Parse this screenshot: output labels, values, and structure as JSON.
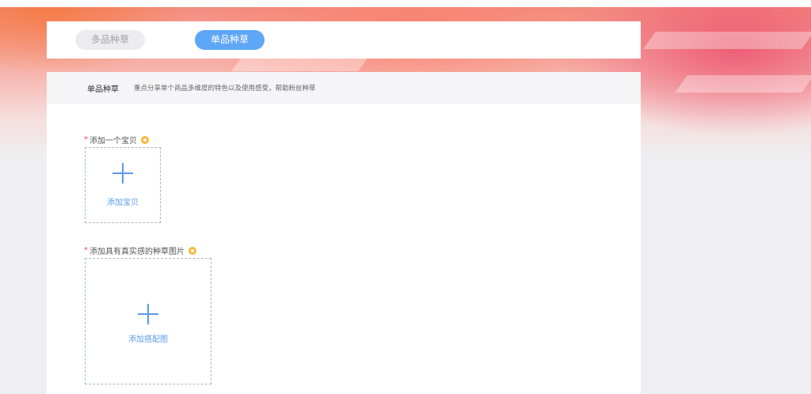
{
  "tabs": {
    "multi": "多品种草",
    "single": "单品种草"
  },
  "description": {
    "title": "单品种草",
    "text": "重点分享单个商品多维度的特色以及使用感受，帮助粉丝种草"
  },
  "fields": {
    "product": {
      "required_mark": "*",
      "label": "添加一个宝贝",
      "button_text": "添加宝贝"
    },
    "image": {
      "required_mark": "*",
      "label": "添加具有真实感的种草图片",
      "button_text": "添加搭配图"
    }
  },
  "colors": {
    "accent": "#5ea6f6",
    "required": "#f04848",
    "help_icon": "#f5b83a"
  }
}
